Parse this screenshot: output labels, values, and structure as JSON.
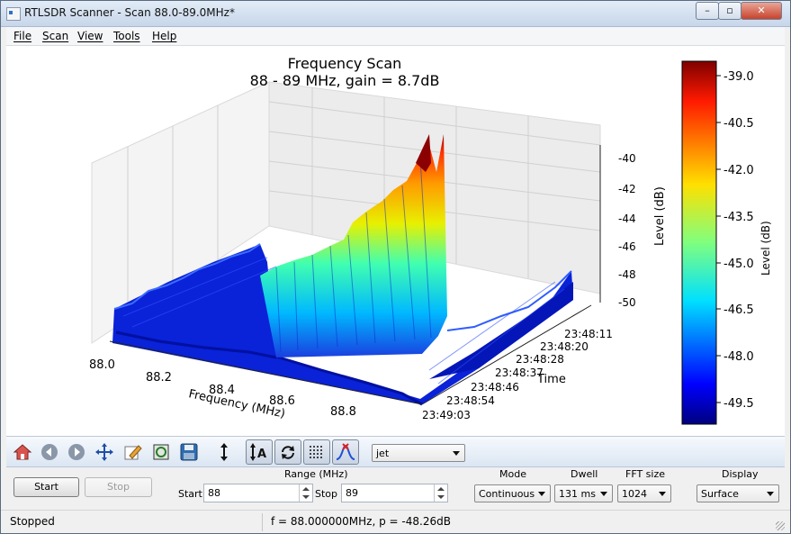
{
  "window": {
    "title": "RTLSDR Scanner - Scan 88.0-89.0MHz*"
  },
  "menu": [
    "File",
    "Scan",
    "View",
    "Tools",
    "Help"
  ],
  "colors": {
    "accent": "#2b57d6",
    "surface_low": "#0000a8",
    "surface_high": "#8b0000"
  },
  "chart_data": {
    "type": "surface",
    "title": "Frequency Scan",
    "subtitle": "88 - 89 MHz, gain = 8.7dB",
    "xlabel": "Frequency (MHz)",
    "ylabel": "Time",
    "zlabel": "Level (dB)",
    "x_ticks": [
      "88.0",
      "88.2",
      "88.4",
      "88.6",
      "88.8"
    ],
    "time_ticks": [
      "23:48:11",
      "23:48:20",
      "23:48:28",
      "23:48:37",
      "23:48:46",
      "23:48:54",
      "23:49:03"
    ],
    "z_ticks": [
      "-40",
      "-42",
      "-44",
      "-46",
      "-48",
      "-50"
    ],
    "colorbar": {
      "label": "Level (dB)",
      "ticks": [
        "-39.0",
        "-40.5",
        "-42.0",
        "-43.5",
        "-45.0",
        "-46.5",
        "-48.0",
        "-49.5"
      ],
      "colormap": "jet",
      "range": [
        -50.0,
        -38.7
      ]
    },
    "peak": {
      "x_range_mhz": [
        88.4,
        88.6
      ],
      "max_db": -38.7
    }
  },
  "toolbar": {
    "icons": [
      "home-icon",
      "back-icon",
      "forward-icon",
      "pan-icon",
      "edit-icon",
      "zoom-icon",
      "save-icon",
      "vertical-resize-icon",
      "auto-range-icon",
      "refresh-icon",
      "grid-icon",
      "peak-icon"
    ],
    "colormap": "jet"
  },
  "controls": {
    "start_label": "Start",
    "stop_label": "Stop",
    "range_label": "Range (MHz)",
    "range_start_label": "Start",
    "range_start_value": "88",
    "range_stop_label": "Stop",
    "range_stop_value": "89",
    "mode_label": "Mode",
    "mode_value": "Continuous",
    "dwell_label": "Dwell",
    "dwell_value": "131 ms",
    "fft_label": "FFT size",
    "fft_value": "1024",
    "display_label": "Display",
    "display_value": "Surface"
  },
  "status": {
    "left": "Stopped",
    "middle": "f = 88.000000MHz, p = -48.26dB"
  }
}
